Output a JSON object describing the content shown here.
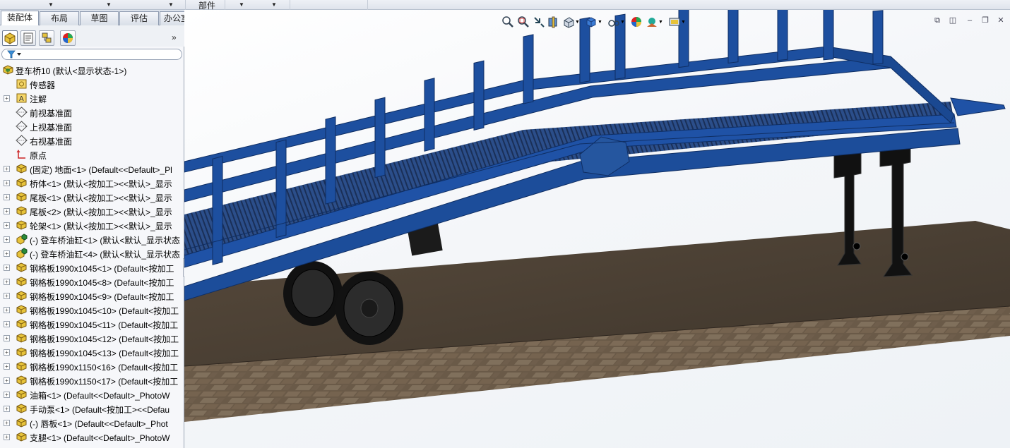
{
  "menubar": {
    "parts_label": "部件"
  },
  "tabs": [
    "装配体",
    "布局",
    "草图",
    "评估",
    "办公室产品"
  ],
  "feature_tree": {
    "items": [
      {
        "label": "登车桥10  (默认<显示状态-1>)",
        "icon": "assembly-icon",
        "level": "root"
      },
      {
        "label": "传感器",
        "icon": "sensor-icon",
        "level": "child"
      },
      {
        "label": "注解",
        "icon": "annotation-icon",
        "level": "child",
        "expandable": true
      },
      {
        "label": "前视基准面",
        "icon": "plane-icon",
        "level": "child"
      },
      {
        "label": "上视基准面",
        "icon": "plane-icon",
        "level": "child"
      },
      {
        "label": "右视基准面",
        "icon": "plane-icon",
        "level": "child"
      },
      {
        "label": "原点",
        "icon": "origin-icon",
        "level": "child"
      },
      {
        "label": "(固定) 地面<1> (Default<<Default>_Pl",
        "icon": "part-icon",
        "level": "child",
        "expandable": true
      },
      {
        "label": "桥体<1> (默认<按加工><<默认>_显示",
        "icon": "part-icon",
        "level": "child",
        "expandable": true
      },
      {
        "label": "尾板<1> (默认<按加工><<默认>_显示",
        "icon": "part-icon",
        "level": "child",
        "expandable": true
      },
      {
        "label": "尾板<2> (默认<按加工><<默认>_显示",
        "icon": "part-icon",
        "level": "child",
        "expandable": true
      },
      {
        "label": "轮架<1> (默认<按加工><<默认>_显示",
        "icon": "part-icon",
        "level": "child",
        "expandable": true
      },
      {
        "label": "(-) 登车桥油缸<1> (默认<默认_显示状态",
        "icon": "subassembly-icon",
        "level": "child",
        "expandable": true
      },
      {
        "label": "(-) 登车桥油缸<4> (默认<默认_显示状态",
        "icon": "subassembly-icon",
        "level": "child",
        "expandable": true
      },
      {
        "label": "钢格板1990x1045<1> (Default<按加工",
        "icon": "part-icon",
        "level": "child",
        "expandable": true
      },
      {
        "label": "钢格板1990x1045<8> (Default<按加工",
        "icon": "part-icon",
        "level": "child",
        "expandable": true
      },
      {
        "label": "钢格板1990x1045<9> (Default<按加工",
        "icon": "part-icon",
        "level": "child",
        "expandable": true
      },
      {
        "label": "钢格板1990x1045<10> (Default<按加工",
        "icon": "part-icon",
        "level": "child",
        "expandable": true
      },
      {
        "label": "钢格板1990x1045<11> (Default<按加工",
        "icon": "part-icon",
        "level": "child",
        "expandable": true
      },
      {
        "label": "钢格板1990x1045<12> (Default<按加工",
        "icon": "part-icon",
        "level": "child",
        "expandable": true
      },
      {
        "label": "钢格板1990x1045<13> (Default<按加工",
        "icon": "part-icon",
        "level": "child",
        "expandable": true
      },
      {
        "label": "钢格板1990x1150<16> (Default<按加工",
        "icon": "part-icon",
        "level": "child",
        "expandable": true
      },
      {
        "label": "钢格板1990x1150<17> (Default<按加工",
        "icon": "part-icon",
        "level": "child",
        "expandable": true
      },
      {
        "label": "油箱<1> (Default<<Default>_PhotoW",
        "icon": "part-icon",
        "level": "child",
        "expandable": true
      },
      {
        "label": "手动泵<1> (Default<按加工><<Defau",
        "icon": "part-icon",
        "level": "child",
        "expandable": true
      },
      {
        "label": "(-) 唇板<1> (Default<<Default>_Phot",
        "icon": "part-icon",
        "level": "child",
        "expandable": true
      },
      {
        "label": "支腿<1> (Default<<Default>_PhotoW",
        "icon": "part-icon",
        "level": "child",
        "expandable": true
      }
    ]
  },
  "colors": {
    "accent": "#1f4f9e",
    "frame": "#1c4d9a",
    "ground": "#4a3f33",
    "tree_bg": "#f6f7fa"
  }
}
